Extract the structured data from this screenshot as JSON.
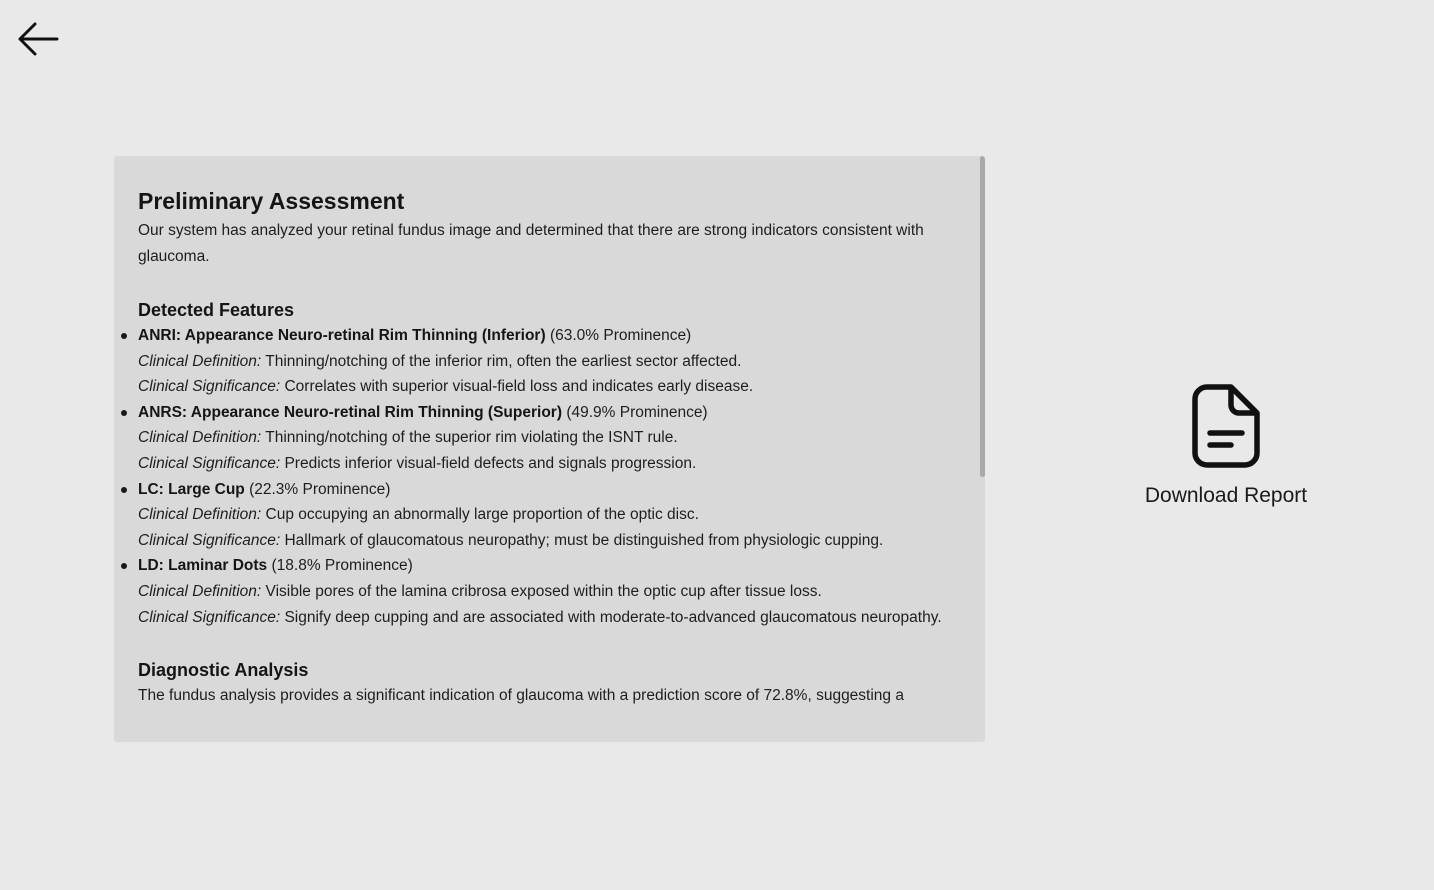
{
  "nav": {
    "back_icon": "arrow-left-icon"
  },
  "report": {
    "preliminary": {
      "title": "Preliminary Assessment",
      "text": "Our system has analyzed your retinal fundus image and determined that there are strong indicators consistent with glaucoma."
    },
    "features": {
      "title": "Detected Features",
      "definition_label": "Clinical Definition:",
      "significance_label": "Clinical Significance:",
      "items": [
        {
          "name": "ANRI: Appearance Neuro-retinal Rim Thinning (Inferior)",
          "prominence": "(63.0% Prominence)",
          "definition": "Thinning/notching of the inferior rim, often the earliest sector affected.",
          "significance": "Correlates with superior visual-field loss and indicates early disease."
        },
        {
          "name": "ANRS: Appearance Neuro-retinal Rim Thinning (Superior)",
          "prominence": "(49.9% Prominence)",
          "definition": "Thinning/notching of the superior rim violating the ISNT rule.",
          "significance": "Predicts inferior visual-field defects and signals progression."
        },
        {
          "name": "LC: Large Cup",
          "prominence": "(22.3% Prominence)",
          "definition": "Cup occupying an abnormally large proportion of the optic disc.",
          "significance": "Hallmark of glaucomatous neuropathy; must be distinguished from physiologic cupping."
        },
        {
          "name": "LD: Laminar Dots",
          "prominence": "(18.8% Prominence)",
          "definition": "Visible pores of the lamina cribrosa exposed within the optic cup after tissue loss.",
          "significance": "Signify deep cupping and are associated with moderate-to-advanced glaucomatous neuropathy."
        }
      ]
    },
    "diagnostic": {
      "title": "Diagnostic Analysis",
      "text": "The fundus analysis provides a significant indication of glaucoma with a prediction score of 72.8%, suggesting a"
    }
  },
  "download": {
    "label": "Download Report",
    "icon": "document-icon"
  }
}
